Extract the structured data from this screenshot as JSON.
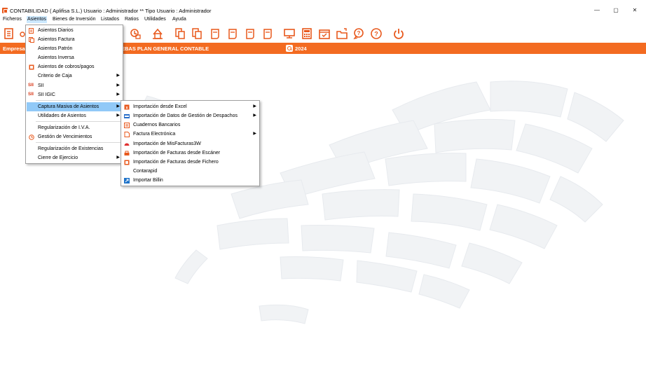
{
  "window": {
    "title": "CONTABILIDAD  ( Aplifisa S.L.)  Usuario : Administrador  **  Tipo Usuario : Administrador",
    "minimize": "—",
    "maximize": "▢",
    "close": "✕"
  },
  "menubar": {
    "items": [
      "Ficheros",
      "Asientos",
      "Bienes de Inversión",
      "Listados",
      "Ratios",
      "Utilidades",
      "Ayuda"
    ]
  },
  "company_bar": {
    "label": "Empresa",
    "company": "EBAS PLAN GENERAL CONTABLE",
    "year": "2024",
    "color": "#f36b21"
  },
  "asientos_menu": {
    "items": [
      {
        "label": "Asientos Diarios",
        "icon": "journal-icon",
        "arrow": ""
      },
      {
        "label": "Asientos Factura",
        "icon": "invoice-icon",
        "arrow": ""
      },
      {
        "label": "Asientos Patrón",
        "icon": "",
        "arrow": ""
      },
      {
        "label": "Asientos Inversa",
        "icon": "",
        "arrow": ""
      },
      {
        "label": "Asientos de cobros/pagos",
        "icon": "payments-icon",
        "arrow": ""
      },
      {
        "label": "Criterio de Caja",
        "icon": "",
        "arrow": "▶"
      },
      {
        "label": "SII",
        "icon": "sii-icon",
        "arrow": "▶"
      },
      {
        "label": "SII IGIC",
        "icon": "sii-icon",
        "arrow": "▶"
      },
      {
        "label": "Captura Masiva de Asientos",
        "icon": "",
        "arrow": "▶"
      },
      {
        "label": "Utilidades de Asientos",
        "icon": "",
        "arrow": "▶"
      },
      {
        "label": "Regularización de I.V.A.",
        "icon": "",
        "arrow": ""
      },
      {
        "label": "Gestión de Vencimientos",
        "icon": "due-dates-icon",
        "arrow": ""
      },
      {
        "label": "Regularización de Existencias",
        "icon": "",
        "arrow": ""
      },
      {
        "label": "Cierre de Ejercicio",
        "icon": "",
        "arrow": "▶"
      }
    ],
    "sii_glyph": "SII"
  },
  "captura_menu": {
    "items": [
      {
        "label": "Importación desde Excel",
        "icon": "excel-icon",
        "arrow": "▶"
      },
      {
        "label": "Importación de Datos de Gestión de Despachos",
        "icon": "office-data-icon",
        "arrow": "▶"
      },
      {
        "label": "Cuadernos Bancarios",
        "icon": "bank-icon",
        "arrow": ""
      },
      {
        "label": "Factura Electrónica",
        "icon": "e-invoice-icon",
        "arrow": "▶"
      },
      {
        "label": "Importación de MisFacturas3W",
        "icon": "misfacturas-icon",
        "arrow": ""
      },
      {
        "label": "Importación de Facturas desde Escáner",
        "icon": "scanner-icon",
        "arrow": ""
      },
      {
        "label": "Importación de Facturas desde Fichero",
        "icon": "file-import-icon",
        "arrow": ""
      },
      {
        "label": "Contarapid",
        "icon": "",
        "arrow": ""
      },
      {
        "label": "Importar Billin",
        "icon": "billin-icon",
        "arrow": ""
      }
    ]
  },
  "toolbar": {
    "icons": [
      "calculator-ledger-icon",
      "accounts-icon",
      "profile-icon",
      "company-home-icon",
      "ledger-icon",
      "copy-ledger-icon",
      "report-icon",
      "balance-icon",
      "statement-icon",
      "accounts-report-icon",
      "monitor-icon",
      "calculator-icon",
      "calendar-icon",
      "folder-icon",
      "chat-icon",
      "help-icon",
      "power-icon"
    ]
  },
  "theme": {
    "accent": "#f36b21",
    "highlight": "#91c9f7",
    "menu_hover": "#cce8ff"
  }
}
